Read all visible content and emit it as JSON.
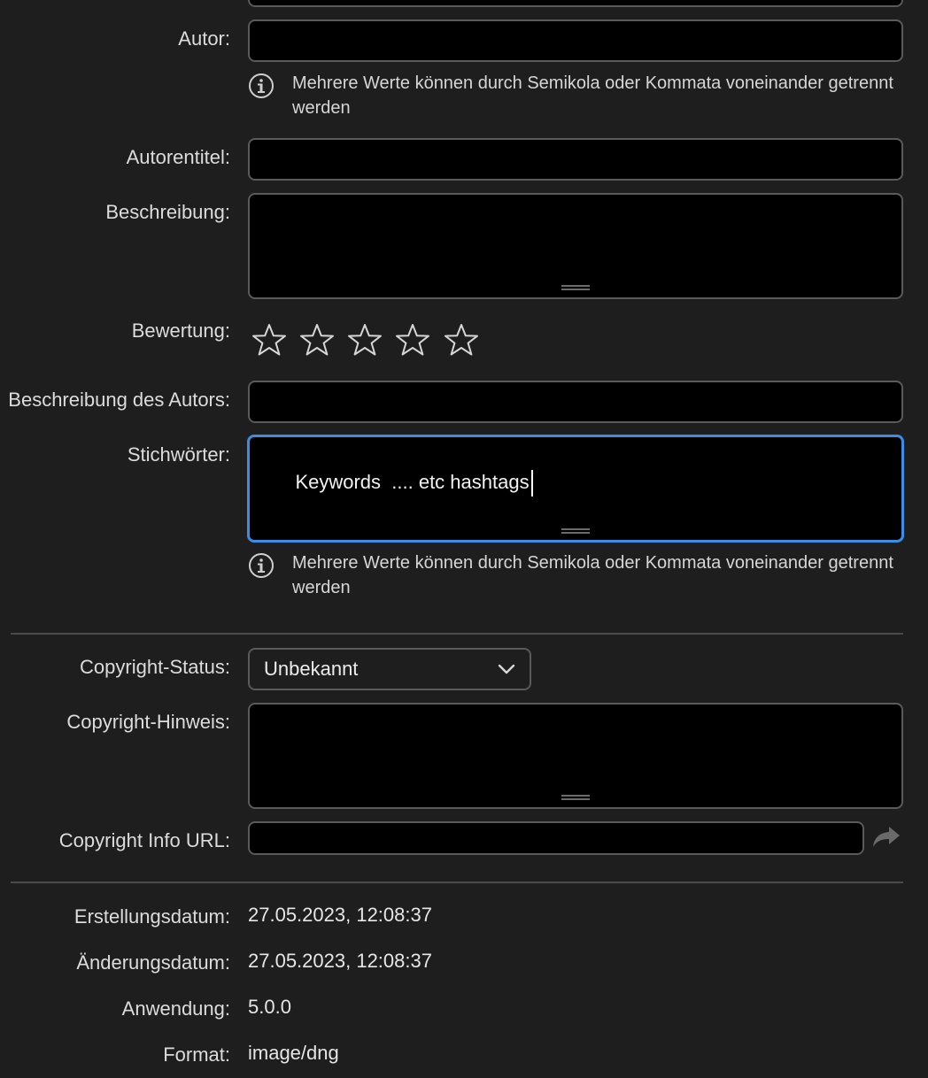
{
  "labels": {
    "author": "Autor:",
    "author_title": "Autorentitel:",
    "description": "Beschreibung:",
    "rating": "Bewertung:",
    "author_description": "Beschreibung des Autors:",
    "keywords": "Stichwörter:",
    "copyright_status": "Copyright-Status:",
    "copyright_notice": "Copyright-Hinweis:",
    "copyright_url": "Copyright Info URL:",
    "created": "Erstellungsdatum:",
    "modified": "Änderungsdatum:",
    "application": "Anwendung:",
    "format": "Format:"
  },
  "fields": {
    "author": "",
    "author_title": "",
    "description": "",
    "author_description": "",
    "keywords": "Keywords  .... etc hashtags",
    "copyright_notice": "",
    "copyright_url": ""
  },
  "hints": {
    "author_multi": "Mehrere Werte können durch Semikola oder Kommata voneinander getrennt werden",
    "keywords_multi": "Mehrere Werte können durch Semikola oder Kommata voneinander getrennt werden"
  },
  "rating": {
    "value": 0,
    "max": 5
  },
  "copyright_status": {
    "selected": "Unbekannt"
  },
  "metadata": {
    "created": "27.05.2023, 12:08:37",
    "modified": "27.05.2023, 12:08:37",
    "application": "5.0.0",
    "format": "image/dng"
  },
  "colors": {
    "background": "#1e1e1e",
    "field_bg": "#000000",
    "focus_border": "#3a8ee6",
    "border": "#5a5a5a"
  },
  "icons": {
    "hint": "info-circle-icon",
    "dropdown": "chevron-down-icon",
    "url_go": "share-arrow-icon",
    "rating": "star-outline-icon"
  }
}
